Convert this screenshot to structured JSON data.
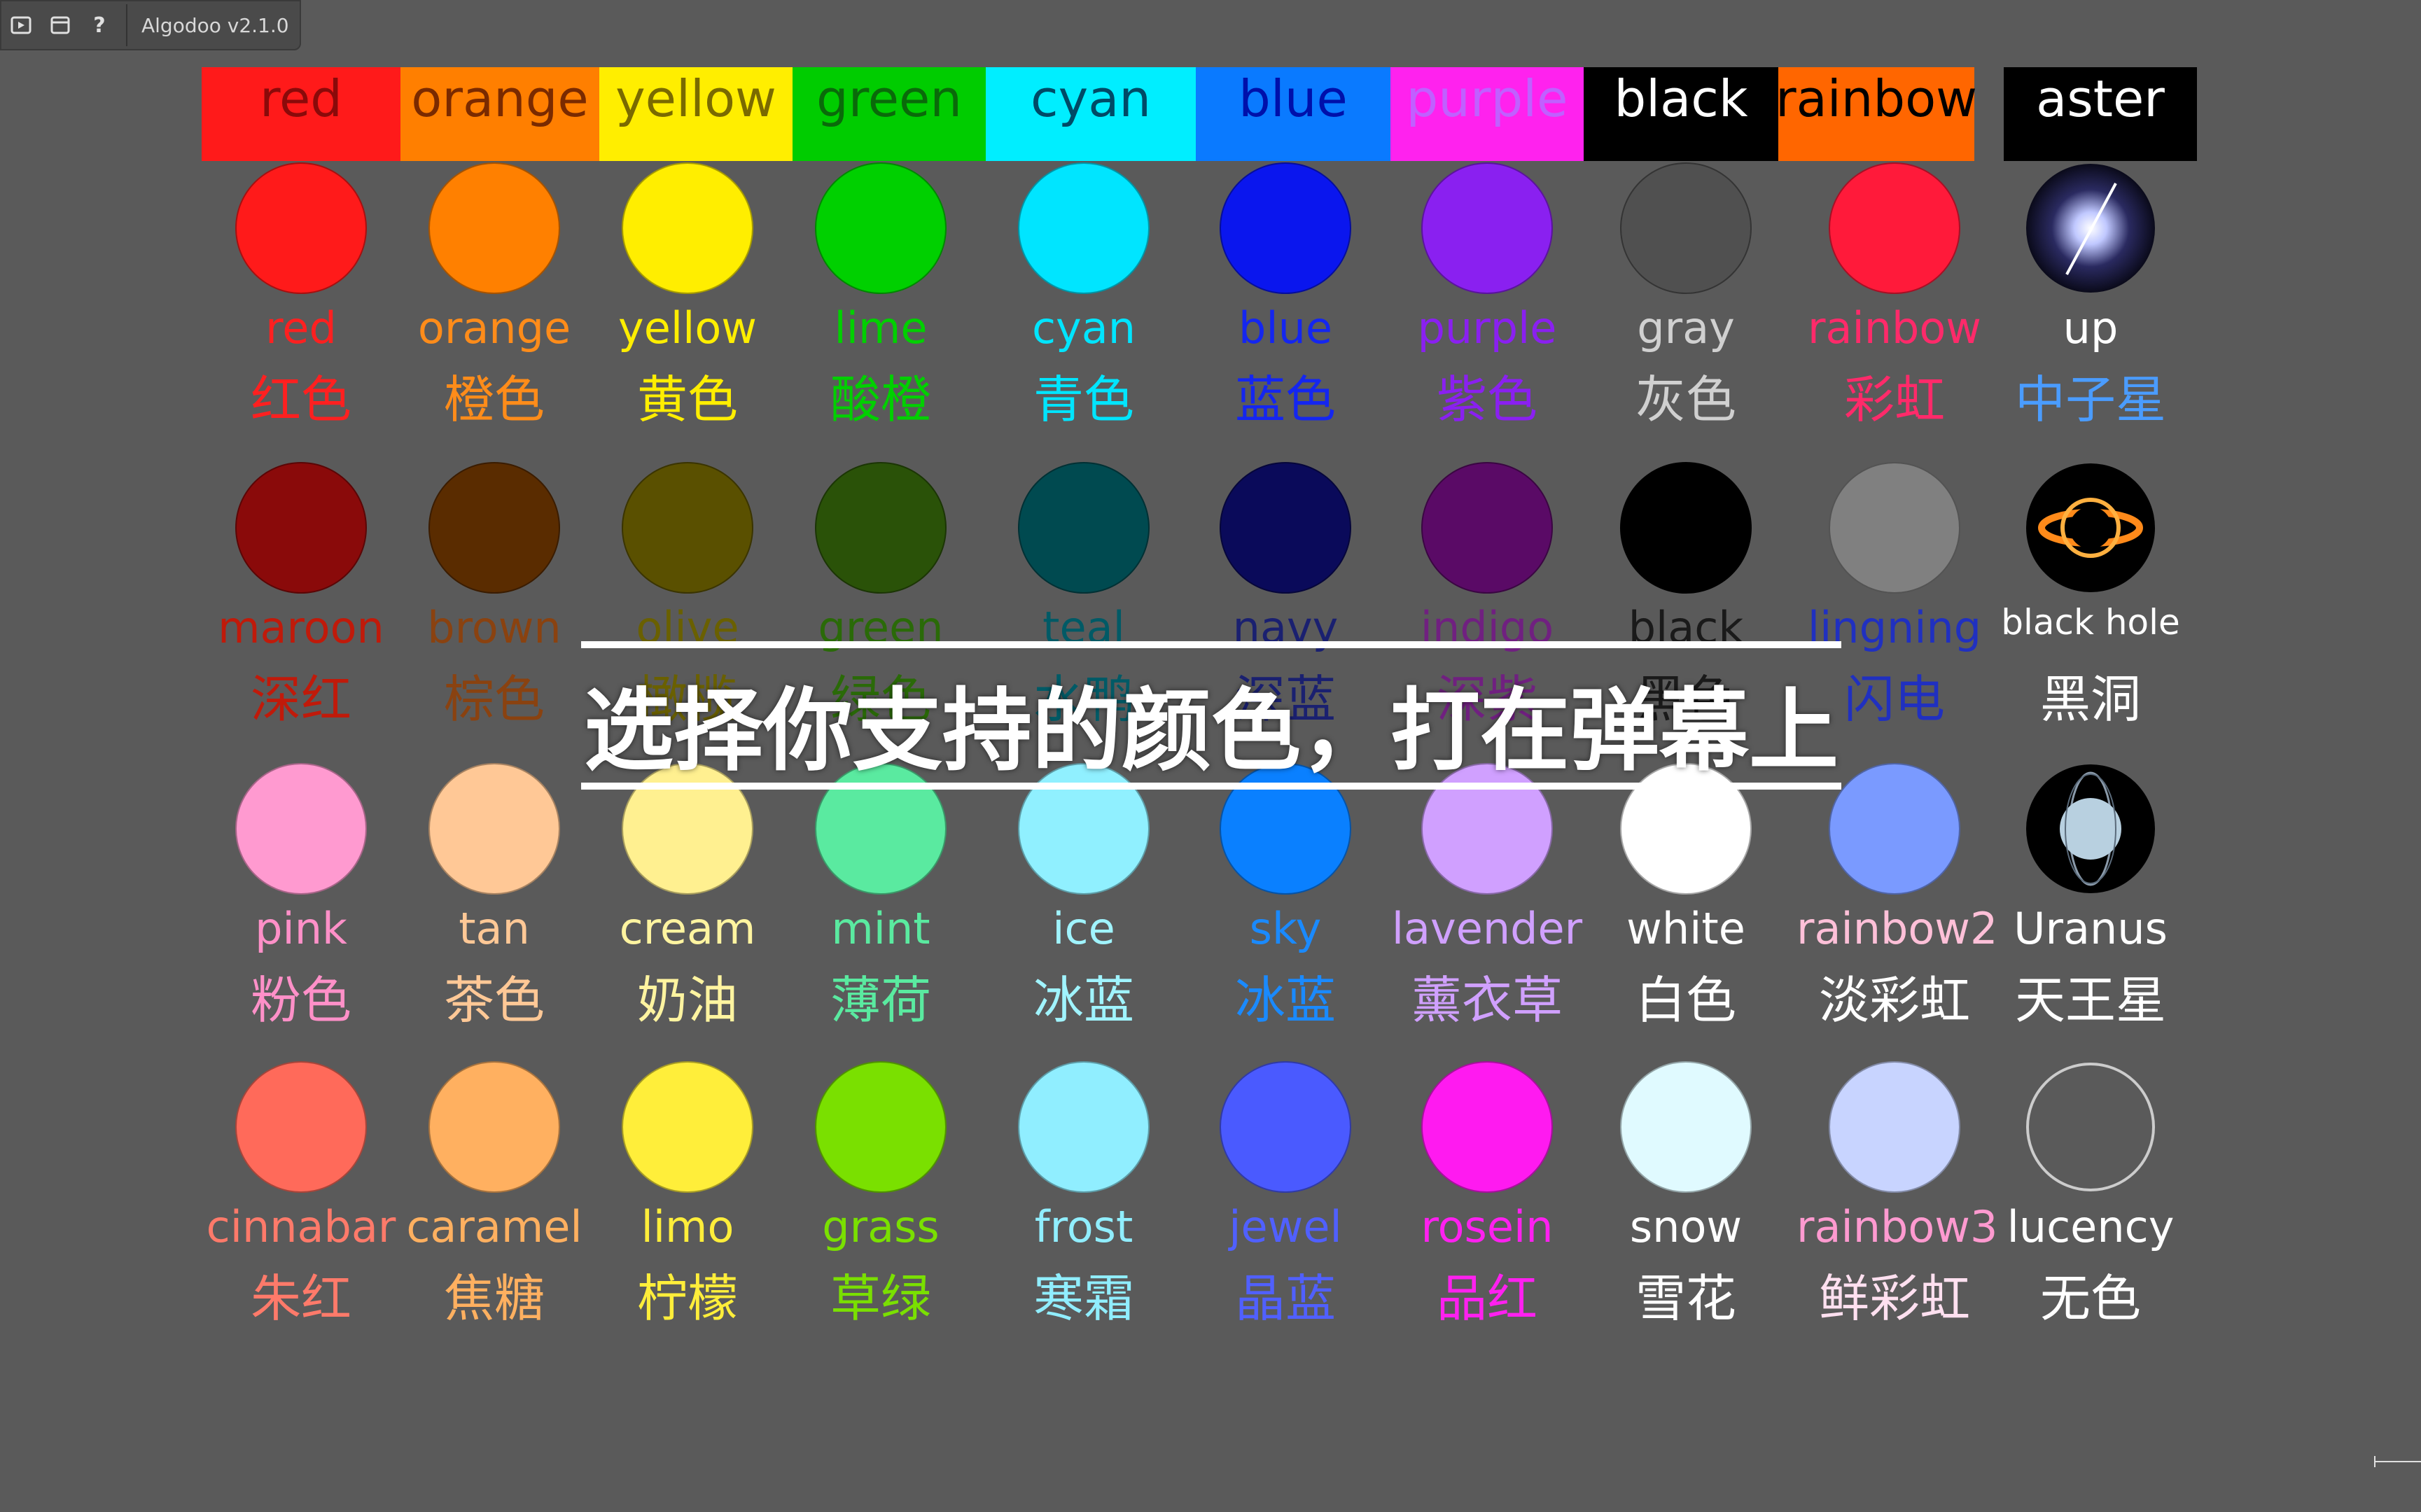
{
  "toolbar": {
    "app_title": "Algodoo v2.1.0",
    "icons": [
      "play-icon",
      "window-icon",
      "help-icon"
    ],
    "help_label": "?"
  },
  "headers": [
    {
      "label": "red",
      "bg": "#ff1a1a",
      "fg": "#8a0a0a"
    },
    {
      "label": "orange",
      "bg": "#ff7f00",
      "fg": "#7a2a00"
    },
    {
      "label": "yellow",
      "bg": "#ffee00",
      "fg": "#7a6a00"
    },
    {
      "label": "green",
      "bg": "#00cc00",
      "fg": "#0a6a0a"
    },
    {
      "label": "cyan",
      "bg": "#00eeff",
      "fg": "#004a66"
    },
    {
      "label": "blue",
      "bg": "#0a7aff",
      "fg": "#0010aa"
    },
    {
      "label": "purple",
      "bg": "#ff22ee",
      "fg": "#c060ff"
    },
    {
      "label": "black",
      "bg": "#000000",
      "fg": "#ffffff"
    },
    {
      "label": "rainbow",
      "bg": "#ff6600",
      "fg": "#000000"
    },
    {
      "label": "aster",
      "bg": "#000000",
      "fg": "#ffffff"
    }
  ],
  "rows": [
    [
      {
        "en": "red",
        "zh": "红色",
        "color": "#ff1a1a",
        "text": "#ff2020"
      },
      {
        "en": "orange",
        "zh": "橙色",
        "color": "#ff8000",
        "text": "#ff8c1a"
      },
      {
        "en": "yellow",
        "zh": "黄色",
        "color": "#ffee00",
        "text": "#ffee00"
      },
      {
        "en": "lime",
        "zh": "酸橙",
        "color": "#00d000",
        "text": "#00d000"
      },
      {
        "en": "cyan",
        "zh": "青色",
        "color": "#00e5ff",
        "text": "#00e5ff"
      },
      {
        "en": "blue",
        "zh": "蓝色",
        "color": "#0a16ee",
        "text": "#1426f0"
      },
      {
        "en": "purple",
        "zh": "紫色",
        "color": "#8a20f0",
        "text": "#8a20f0"
      },
      {
        "en": "gray",
        "zh": "灰色",
        "color": "#505050",
        "text": "#d0d0d0"
      },
      {
        "en": "rainbow",
        "zh": "彩虹",
        "color": "#ff1a3a",
        "text": "#ff2a6a"
      },
      {
        "en": "up",
        "zh": "中子星",
        "color": "#1a1a30",
        "text": "#ffffff",
        "zh_text": "#4a9cff",
        "icon": "neutron-star-icon"
      }
    ],
    [
      {
        "en": "maroon",
        "zh": "深红",
        "color": "#8a0a0a",
        "text": "#c01a0a"
      },
      {
        "en": "brown",
        "zh": "棕色",
        "color": "#5a2c00",
        "text": "#8a4210"
      },
      {
        "en": "olive",
        "zh": "橄榄",
        "color": "#5a5000",
        "text": "#6a6000"
      },
      {
        "en": "green",
        "zh": "绿色",
        "color": "#2a5208",
        "text": "#2a6a08"
      },
      {
        "en": "teal",
        "zh": "水鸭",
        "color": "#004a50",
        "text": "#005a66"
      },
      {
        "en": "navy",
        "zh": "深蓝",
        "color": "#0a0a5a",
        "text": "#1a2070"
      },
      {
        "en": "indigo",
        "zh": "深紫",
        "color": "#5a0a66",
        "text": "#702080"
      },
      {
        "en": "black",
        "zh": "黑色",
        "color": "#000000",
        "text": "#1a1a1a"
      },
      {
        "en": "lingning",
        "zh": "闪电",
        "color": "#808080",
        "text": "#2030c0"
      },
      {
        "en": "black hole",
        "zh": "黑洞",
        "color": "#0a0a0a",
        "text": "#ffffff",
        "icon": "black-hole-icon"
      }
    ],
    [
      {
        "en": "pink",
        "zh": "粉色",
        "color": "#ff9ad0",
        "text": "#ff90c8"
      },
      {
        "en": "tan",
        "zh": "茶色",
        "color": "#ffc896",
        "text": "#ffc896"
      },
      {
        "en": "cream",
        "zh": "奶油",
        "color": "#fff090",
        "text": "#fff4a0"
      },
      {
        "en": "mint",
        "zh": "薄荷",
        "color": "#5aeaa0",
        "text": "#5aeaa0"
      },
      {
        "en": "ice",
        "zh": "冰蓝",
        "color": "#90f0ff",
        "text": "#a0f4ff"
      },
      {
        "en": "sky",
        "zh": "冰蓝",
        "color": "#0a80ff",
        "text": "#1a8aff"
      },
      {
        "en": "lavender",
        "zh": "薰衣草",
        "color": "#d0a0ff",
        "text": "#d0a0ff"
      },
      {
        "en": "white",
        "zh": "白色",
        "color": "#ffffff",
        "text": "#ffffff"
      },
      {
        "en": "rainbow2",
        "zh": "淡彩虹",
        "color": "#7a9aff",
        "text": "#ffc0d8",
        "zh_text": "#ffffff"
      },
      {
        "en": "Uranus",
        "zh": "天王星",
        "color": "#0a0a0a",
        "text": "#ffffff",
        "icon": "uranus-icon"
      }
    ],
    [
      {
        "en": "cinnabar",
        "zh": "朱红",
        "color": "#ff6a5a",
        "text": "#ff7a6a"
      },
      {
        "en": "caramel",
        "zh": "焦糖",
        "color": "#ffb060",
        "text": "#ffb060"
      },
      {
        "en": "limo",
        "zh": "柠檬",
        "color": "#ffee3a",
        "text": "#ffee3a"
      },
      {
        "en": "grass",
        "zh": "草绿",
        "color": "#7ae000",
        "text": "#7ae000"
      },
      {
        "en": "frost",
        "zh": "寒霜",
        "color": "#90eeff",
        "text": "#90eeff"
      },
      {
        "en": "jewel",
        "zh": "晶蓝",
        "color": "#4a5aff",
        "text": "#5060ff"
      },
      {
        "en": "rosein",
        "zh": "品红",
        "color": "#ff1af0",
        "text": "#ff20f0"
      },
      {
        "en": "snow",
        "zh": "雪花",
        "color": "#e0faff",
        "text": "#ffffff"
      },
      {
        "en": "rainbow3",
        "zh": "鲜彩虹",
        "color": "#c8d4ff",
        "text": "#ff9ad0",
        "zh_text": "#ffe0f0"
      },
      {
        "en": "lucency",
        "zh": "无色",
        "color": "transparent",
        "text": "#ffffff",
        "icon": "lucency-ring-icon"
      }
    ]
  ],
  "overlay": {
    "caption": "选择你支持的颜色，打在弹幕上"
  }
}
